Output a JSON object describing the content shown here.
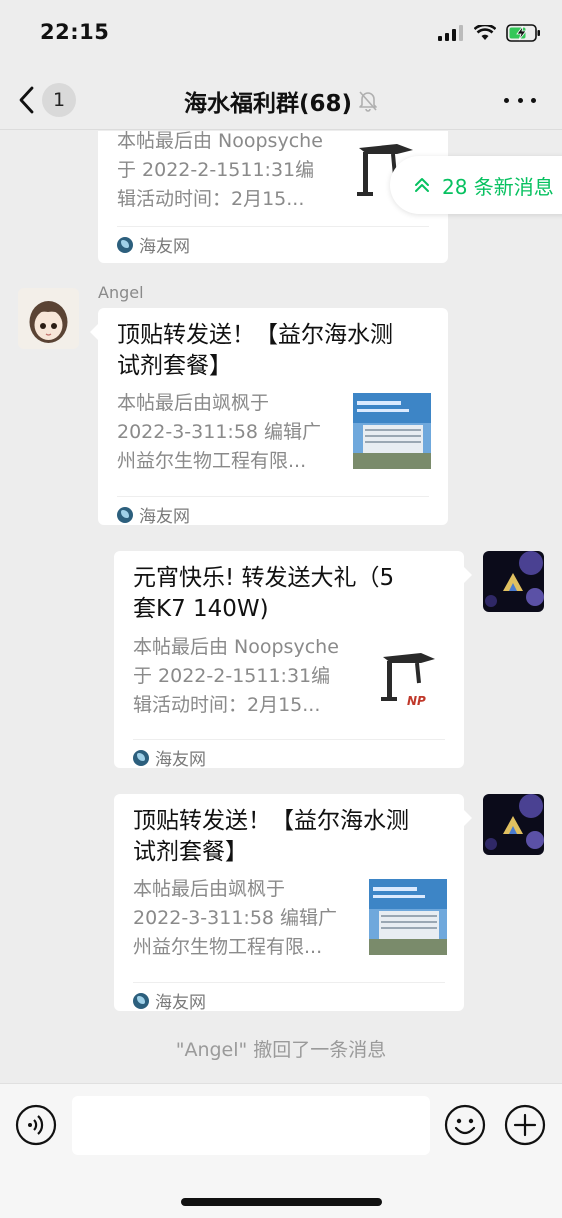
{
  "status": {
    "time": "22:15"
  },
  "nav": {
    "unread_count": "1",
    "title": "海水福利群(68)"
  },
  "new_messages": {
    "label": "28 条新消息"
  },
  "messages": [
    {
      "title": "",
      "desc_lines": [
        "本帖最后由 Noopsyche",
        "于 2022-2-1511:31编",
        "辑活动时间：2月15..."
      ],
      "source": "海友网",
      "thumb": "noopsyche-light-image"
    },
    {
      "sender": "Angel",
      "title_lines": [
        "顶贴转发送！【益尔海水测",
        "试剂套餐】"
      ],
      "desc_lines": [
        "本帖最后由飒枫于",
        "2022-3-311:58 编辑广",
        "州益尔生物工程有限..."
      ],
      "source": "海友网",
      "thumb": "company-building-image"
    },
    {
      "title_lines": [
        "元宵快乐! 转发送大礼（5",
        "套K7  140W)"
      ],
      "desc_lines": [
        "本帖最后由 Noopsyche",
        "于 2022-2-1511:31编",
        "辑活动时间：2月15..."
      ],
      "source": "海友网",
      "thumb": "noopsyche-light-image",
      "thumb_logo": "NP"
    },
    {
      "title_lines": [
        "顶贴转发送！【益尔海水测",
        "试剂套餐】"
      ],
      "desc_lines": [
        "本帖最后由飒枫于",
        "2022-3-311:58 编辑广",
        "州益尔生物工程有限..."
      ],
      "source": "海友网",
      "thumb": "company-building-image"
    }
  ],
  "recall_notice": "\"Angel\" 撤回了一条消息",
  "colors": {
    "accent": "#07c160",
    "background": "#ededed"
  }
}
